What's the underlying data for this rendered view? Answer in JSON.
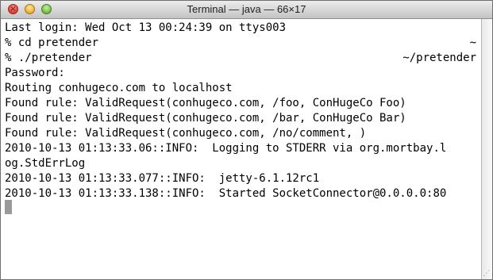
{
  "window": {
    "title": "Terminal — java — 66×17"
  },
  "titlebar_buttons": {
    "close": {
      "icon": "close-icon",
      "color": "#e0443a"
    },
    "minimize": {
      "icon": "minimize-icon",
      "color": "#f3b53a"
    },
    "zoom": {
      "icon": "zoom-icon",
      "color": "#7bc24a"
    }
  },
  "terminal": {
    "lines": [
      "Last login: Wed Oct 13 00:24:39 on ttys003",
      "% cd pretender",
      "% ./pretender",
      "Password:",
      "Routing conhugeco.com to localhost",
      "Found rule: ValidRequest(conhugeco.com, /foo, ConHugeCo Foo)",
      "Found rule: ValidRequest(conhugeco.com, /bar, ConHugeCo Bar)",
      "Found rule: ValidRequest(conhugeco.com, /no/comment, )",
      "2010-10-13 01:13:33.06::INFO:  Logging to STDERR via org.mortbay.l",
      "og.StdErrLog",
      "2010-10-13 01:13:33.077::INFO:  jetty-6.1.12rc1",
      "2010-10-13 01:13:33.138::INFO:  Started SocketConnector@0.0.0.0:80"
    ],
    "right_prompts": {
      "line_2": "~",
      "line_3": "~/pretender"
    },
    "background": "#ffffff",
    "foreground": "#000000",
    "cursor_color": "#9a9a9a"
  },
  "scrollbar": {
    "grip_icon": "resize-grip-icon"
  }
}
